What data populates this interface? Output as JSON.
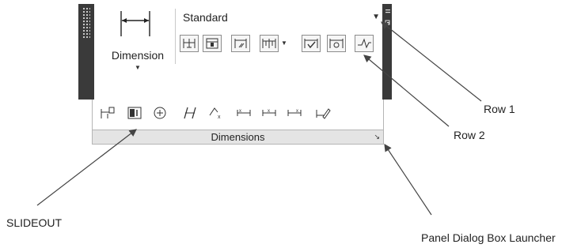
{
  "panel": {
    "dimension_label": "Dimension",
    "style_value": "Standard",
    "title": "Dimensions",
    "row1_icons": [
      "linear-dimension-icon",
      "quick-dimension-icon",
      "dimension-style-icon",
      "continue-dimension-icon",
      "check-dimension-icon",
      "reassociate-dimension-icon",
      "jogged-line-icon"
    ],
    "row2_icons": [
      "tolerance-icon",
      "center-mark-icon",
      "center-circle-icon",
      "oblique-icon",
      "text-angle-icon",
      "justify-left-icon",
      "justify-center-icon",
      "justify-right-icon",
      "override-icon"
    ]
  },
  "callouts": {
    "row1": "Row 1",
    "row2": "Row 2",
    "slideout": "SLIDEOUT",
    "launcher": "Panel Dialog Box Launcher"
  }
}
